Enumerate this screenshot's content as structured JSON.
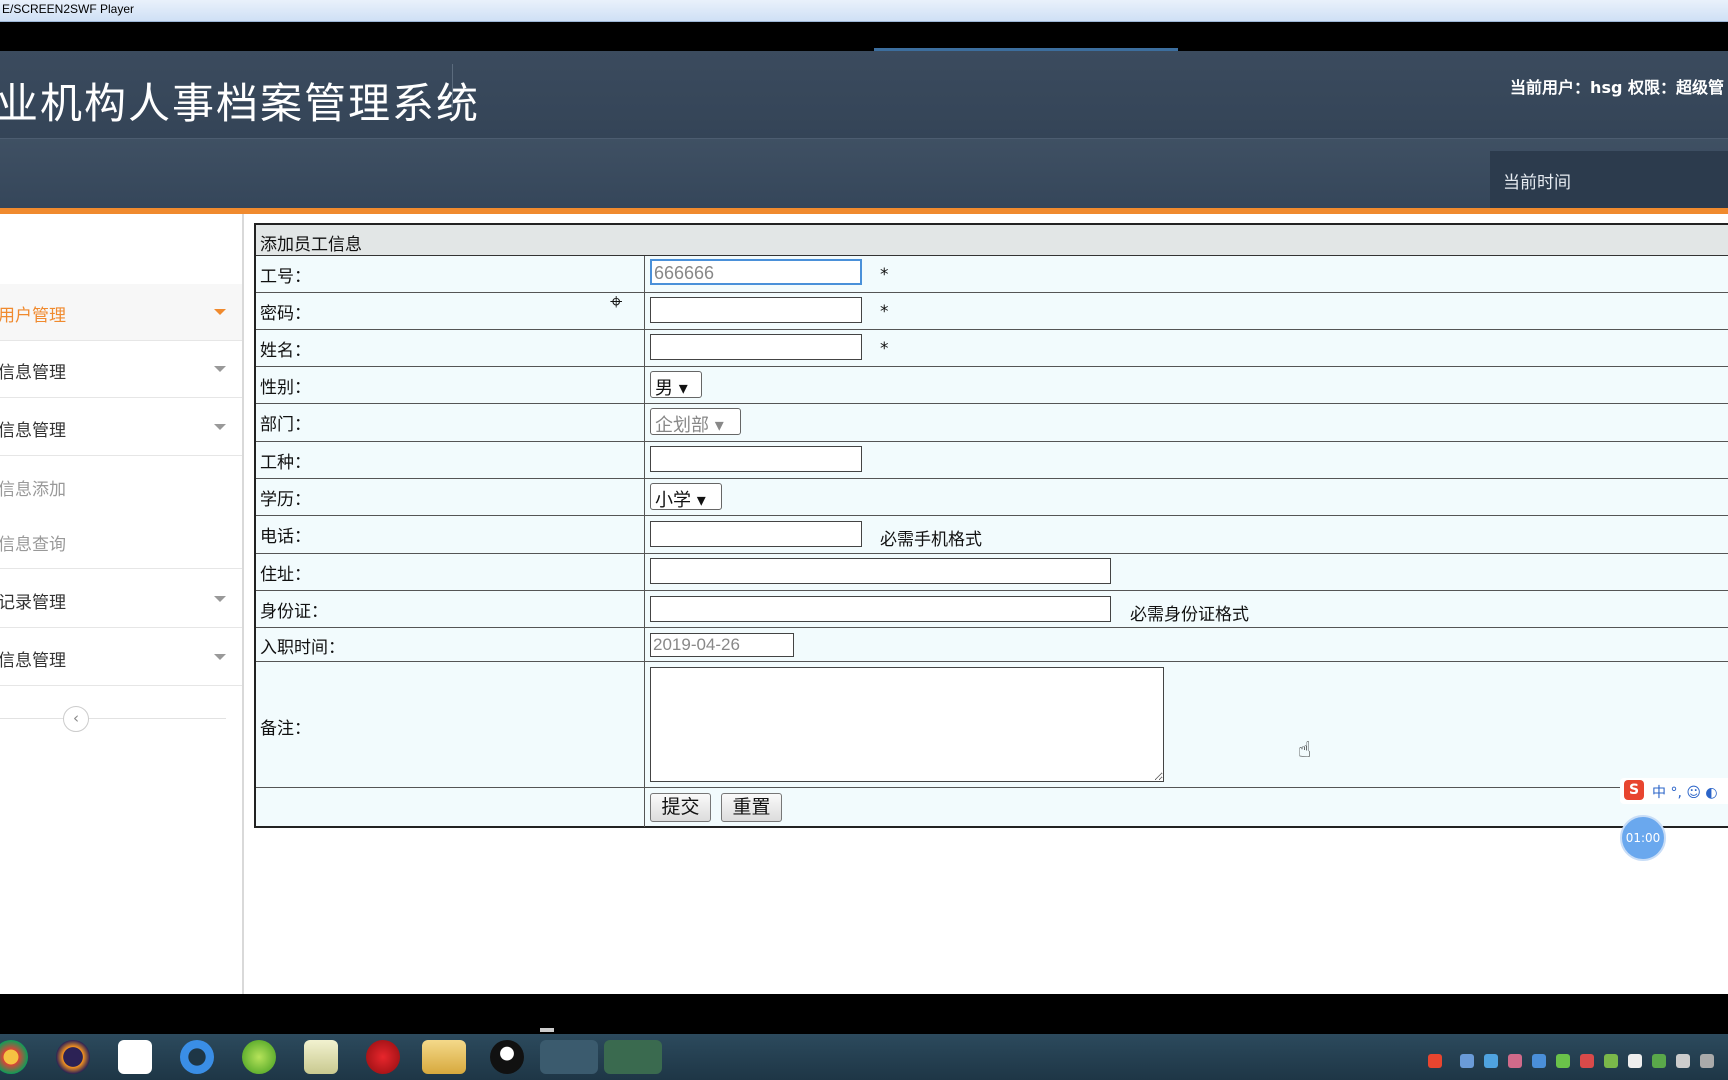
{
  "window": {
    "title": "E/SCREEN2SWF Player"
  },
  "header": {
    "title": "业机构人事档案管理系统",
    "user_info": "当前用户：hsg  权限：超级管",
    "time_label": "当前时间"
  },
  "sidebar": {
    "items": [
      {
        "label": "用户管理",
        "active": true
      },
      {
        "label": "信息管理"
      },
      {
        "label": "信息管理"
      },
      {
        "label": "信息添加",
        "sub": true
      },
      {
        "label": "信息查询",
        "sub": true
      },
      {
        "label": "记录管理"
      },
      {
        "label": "信息管理"
      }
    ],
    "collapse_icon": "‹"
  },
  "form": {
    "title": "添加员工信息",
    "rows": {
      "emp_id": {
        "label": "工号：",
        "value": "666666",
        "required": "*"
      },
      "password": {
        "label": "密码：",
        "value": "",
        "required": "*"
      },
      "name": {
        "label": "姓名：",
        "value": "",
        "required": "*"
      },
      "gender": {
        "label": "性别：",
        "selected": "男"
      },
      "dept": {
        "label": "部门：",
        "selected": "企划部"
      },
      "job_type": {
        "label": "工种：",
        "value": ""
      },
      "education": {
        "label": "学历：",
        "selected": "小学"
      },
      "phone": {
        "label": "电话：",
        "value": "",
        "hint": "必需手机格式"
      },
      "address": {
        "label": "住址：",
        "value": ""
      },
      "id_card": {
        "label": "身份证：",
        "value": "",
        "hint": "必需身份证格式"
      },
      "join_date": {
        "label": "入职时间：",
        "value": "2019-04-26"
      },
      "remarks": {
        "label": "备注：",
        "value": ""
      }
    },
    "submit_label": "提交",
    "reset_label": "重置"
  },
  "overlay": {
    "ime_logo": "S",
    "ime_text": "中 °, ☺ ◐",
    "timer": "01:00"
  },
  "colors": {
    "accent": "#f08a2e",
    "header_bg": "#3b4b5e",
    "form_bg": "#f2fbfd"
  }
}
